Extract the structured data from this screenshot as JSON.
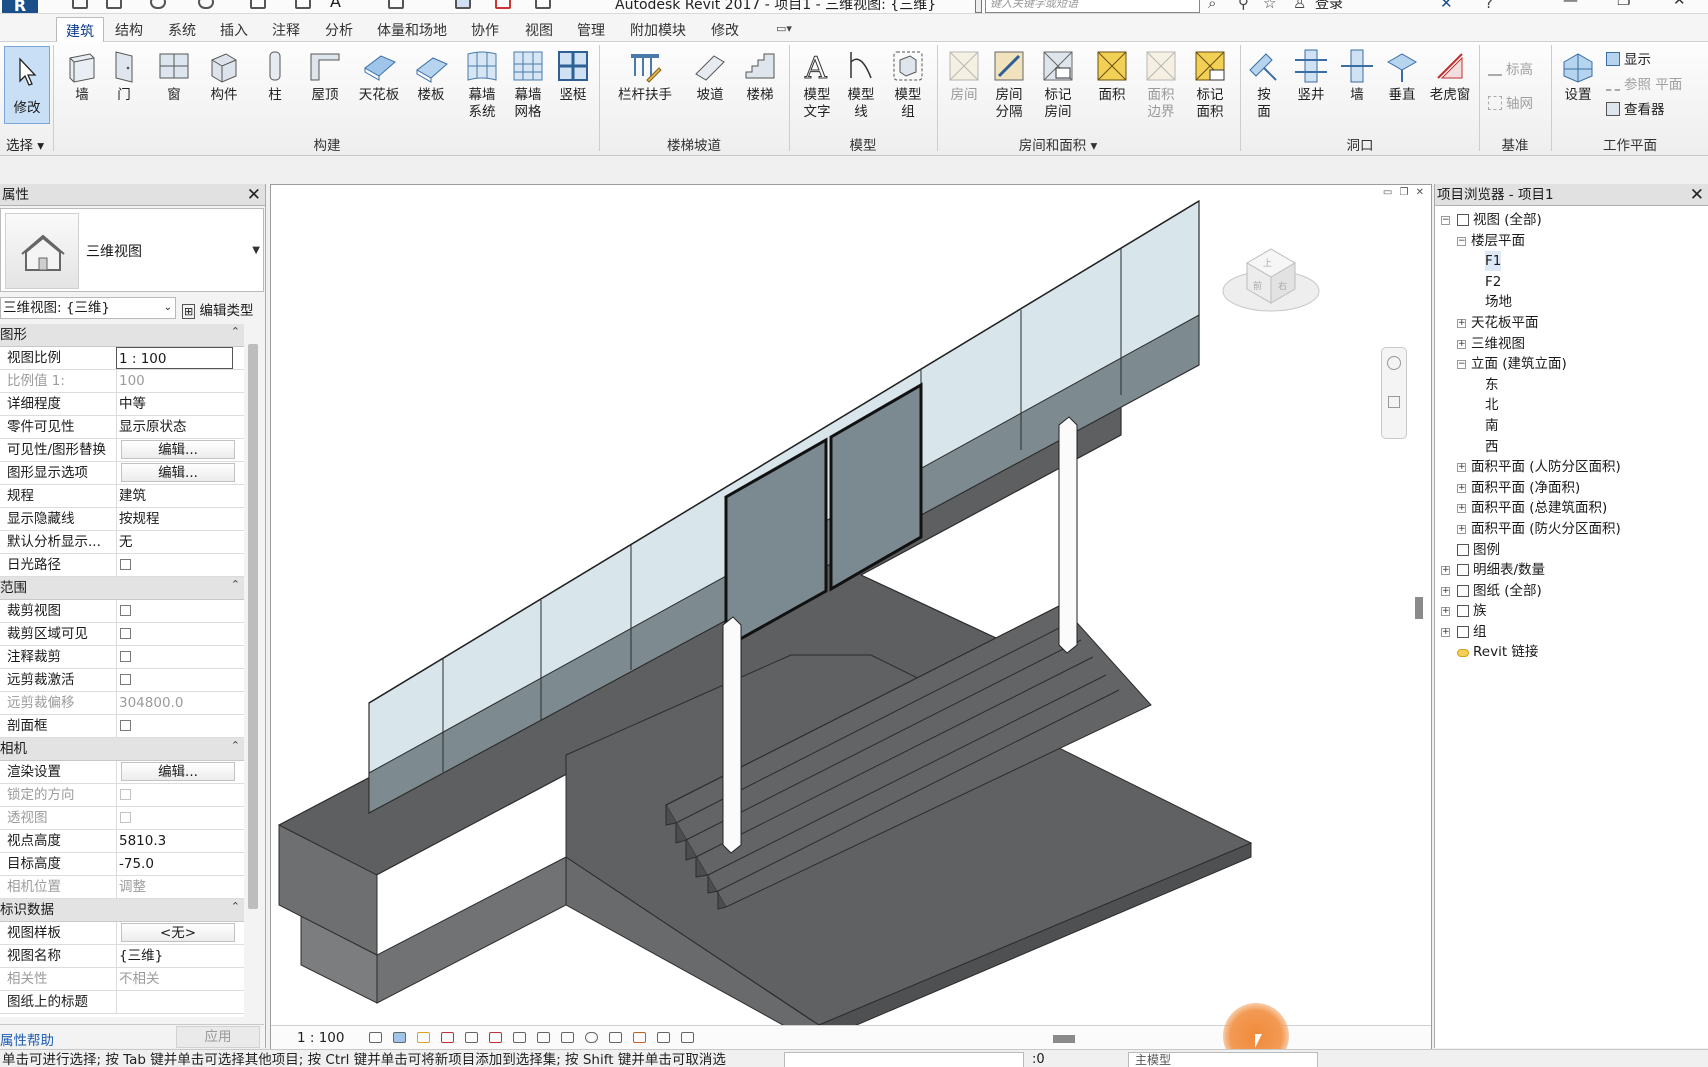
{
  "titlebar": {
    "title": "Autodesk Revit 2017 -    项目1 - 三维视图: {三维}",
    "search_placeholder": "键入关键字或短语",
    "login": "登录",
    "logo": "R"
  },
  "menu": {
    "tabs": [
      "建筑",
      "结构",
      "系统",
      "插入",
      "注释",
      "分析",
      "体量和场地",
      "协作",
      "视图",
      "管理",
      "附加模块",
      "修改"
    ],
    "active": "建筑"
  },
  "ribbon": {
    "modify": "修改",
    "select": "选择",
    "build": {
      "label": "构建",
      "buttons": [
        "墙",
        "门",
        "窗",
        "构件",
        "柱",
        "屋顶",
        "天花板",
        "楼板",
        "幕墙\n系统",
        "幕墙\n网格",
        "竖梃"
      ]
    },
    "stairs": {
      "label": "楼梯坡道",
      "buttons": [
        "栏杆扶手",
        "坡道",
        "楼梯"
      ]
    },
    "model": {
      "label": "模型",
      "buttons": [
        "模型\n文字",
        "模型\n线",
        "模型\n组"
      ]
    },
    "rooms": {
      "label": "房间和面积",
      "buttons": [
        {
          "label": "房间",
          "disabled": true
        },
        {
          "label": "房间\n分隔",
          "disabled": false
        },
        {
          "label": "标记\n房间",
          "disabled": false
        },
        {
          "label": "面积",
          "disabled": false
        },
        {
          "label": "面积\n边界",
          "disabled": true
        },
        {
          "label": "标记\n面积",
          "disabled": false
        }
      ]
    },
    "opening": {
      "label": "洞口",
      "buttons": [
        "按\n面",
        "竖井",
        "墙",
        "垂直",
        "老虎窗"
      ]
    },
    "datum": {
      "label": "基准",
      "items": [
        "标高",
        "轴网"
      ]
    },
    "workplane": {
      "label": "工作平面",
      "set": "设置",
      "items": [
        "显示",
        "参照 平面",
        "查看器"
      ]
    }
  },
  "properties": {
    "title": "属性",
    "type_name": "三维视图",
    "instance": "三维视图: {三维}",
    "edit_type": "编辑类型",
    "groups": [
      {
        "name": "图形",
        "rows": [
          {
            "k": "视图比例",
            "v": "1 : 100",
            "t": "box"
          },
          {
            "k": "比例值 1:",
            "v": "100",
            "t": "dis"
          },
          {
            "k": "详细程度",
            "v": "中等",
            "t": "text"
          },
          {
            "k": "零件可见性",
            "v": "显示原状态",
            "t": "text"
          },
          {
            "k": "可见性/图形替换",
            "v": "编辑...",
            "t": "btn"
          },
          {
            "k": "图形显示选项",
            "v": "编辑...",
            "t": "btn"
          },
          {
            "k": "规程",
            "v": "建筑",
            "t": "text"
          },
          {
            "k": "显示隐藏线",
            "v": "按规程",
            "t": "text"
          },
          {
            "k": "默认分析显示...",
            "v": "无",
            "t": "text"
          },
          {
            "k": "日光路径",
            "v": "",
            "t": "check"
          }
        ]
      },
      {
        "name": "范围",
        "rows": [
          {
            "k": "裁剪视图",
            "v": "",
            "t": "check"
          },
          {
            "k": "裁剪区域可见",
            "v": "",
            "t": "check"
          },
          {
            "k": "注释裁剪",
            "v": "",
            "t": "check"
          },
          {
            "k": "远剪裁激活",
            "v": "",
            "t": "check"
          },
          {
            "k": "远剪裁偏移",
            "v": "304800.0",
            "t": "dis"
          },
          {
            "k": "剖面框",
            "v": "",
            "t": "check"
          }
        ]
      },
      {
        "name": "相机",
        "rows": [
          {
            "k": "渲染设置",
            "v": "编辑...",
            "t": "btn"
          },
          {
            "k": "锁定的方向",
            "v": "",
            "t": "discheck"
          },
          {
            "k": "透视图",
            "v": "",
            "t": "discheck"
          },
          {
            "k": "视点高度",
            "v": "5810.3",
            "t": "text"
          },
          {
            "k": "目标高度",
            "v": "-75.0",
            "t": "text"
          },
          {
            "k": "相机位置",
            "v": "调整",
            "t": "dis"
          }
        ]
      },
      {
        "name": "标识数据",
        "rows": [
          {
            "k": "视图样板",
            "v": "<无>",
            "t": "btn"
          },
          {
            "k": "视图名称",
            "v": "{三维}",
            "t": "text"
          },
          {
            "k": "相关性",
            "v": "不相关",
            "t": "dis"
          },
          {
            "k": "图纸上的标题",
            "v": "",
            "t": "text"
          }
        ]
      }
    ],
    "help": "属性帮助",
    "apply": "应用"
  },
  "view": {
    "scale": "1 : 100",
    "viewcube_faces": [
      "上",
      "右",
      "前"
    ]
  },
  "browser": {
    "title": "项目浏览器 - 项目1",
    "tree": [
      {
        "level": 0,
        "exp": "-",
        "label": "视图 (全部)",
        "icon": "views"
      },
      {
        "level": 1,
        "exp": "-",
        "label": "楼层平面"
      },
      {
        "level": 2,
        "exp": "",
        "label": "F1",
        "selected": true
      },
      {
        "level": 2,
        "exp": "",
        "label": "F2"
      },
      {
        "level": 2,
        "exp": "",
        "label": "场地"
      },
      {
        "level": 1,
        "exp": "+",
        "label": "天花板平面"
      },
      {
        "level": 1,
        "exp": "+",
        "label": "三维视图"
      },
      {
        "level": 1,
        "exp": "-",
        "label": "立面 (建筑立面)"
      },
      {
        "level": 2,
        "exp": "",
        "label": "东"
      },
      {
        "level": 2,
        "exp": "",
        "label": "北"
      },
      {
        "level": 2,
        "exp": "",
        "label": "南"
      },
      {
        "level": 2,
        "exp": "",
        "label": "西"
      },
      {
        "level": 1,
        "exp": "+",
        "label": "面积平面 (人防分区面积)"
      },
      {
        "level": 1,
        "exp": "+",
        "label": "面积平面 (净面积)"
      },
      {
        "level": 1,
        "exp": "+",
        "label": "面积平面 (总建筑面积)"
      },
      {
        "level": 1,
        "exp": "+",
        "label": "面积平面 (防火分区面积)"
      },
      {
        "level": 0,
        "exp": "",
        "label": "图例",
        "icon": "legend"
      },
      {
        "level": 0,
        "exp": "+",
        "label": "明细表/数量",
        "icon": "schedule"
      },
      {
        "level": 0,
        "exp": "+",
        "label": "图纸 (全部)",
        "icon": "sheets"
      },
      {
        "level": 0,
        "exp": "+",
        "label": "族",
        "icon": "family"
      },
      {
        "level": 0,
        "exp": "+",
        "label": "组",
        "icon": "group"
      },
      {
        "level": 0,
        "exp": "",
        "label": "Revit 链接",
        "icon": "link"
      }
    ]
  },
  "status": {
    "text": "单击可进行选择; 按 Tab 键并单击可选择其他项目; 按 Ctrl 键并单击可将新项目添加到选择集; 按 Shift 键并单击可取消选",
    "zero": ":0",
    "model": "主模型"
  }
}
